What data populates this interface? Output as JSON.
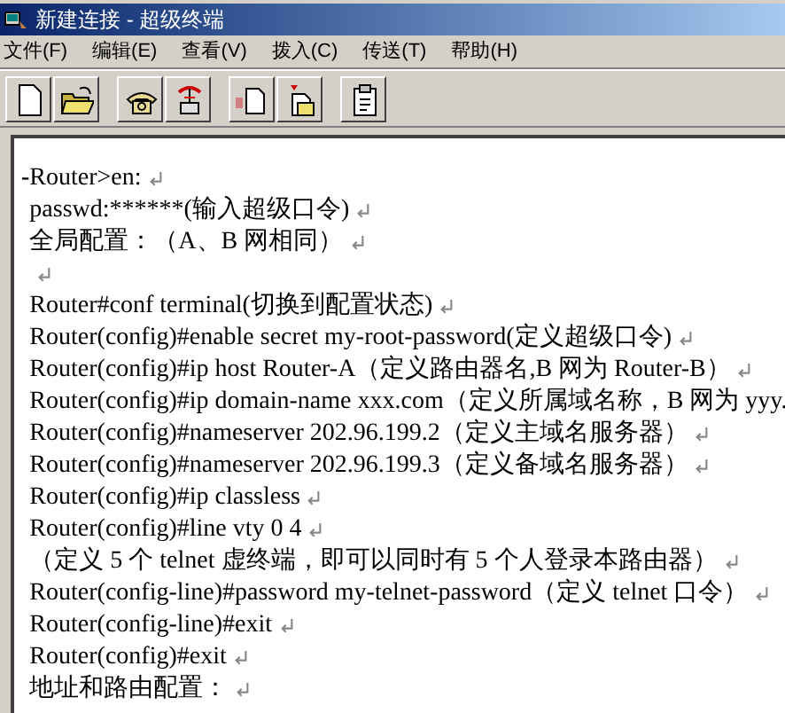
{
  "window": {
    "title": "新建连接 - 超级终端"
  },
  "menu": [
    "文件(F)",
    "编辑(E)",
    "查看(V)",
    "拨入(C)",
    "传送(T)",
    "帮助(H)"
  ],
  "toolbar": [
    {
      "kind": "new"
    },
    {
      "kind": "open"
    },
    {
      "kind": "separator"
    },
    {
      "kind": "call"
    },
    {
      "kind": "hangup"
    },
    {
      "kind": "separator"
    },
    {
      "kind": "send"
    },
    {
      "kind": "receive"
    },
    {
      "kind": "separator"
    },
    {
      "kind": "properties"
    }
  ],
  "terminal": {
    "cursor": "-",
    "lines": [
      {
        "text": "Router>en:",
        "mark": true
      },
      {
        "text": "passwd:******(输入超级口令)",
        "mark": true
      },
      {
        "text": "全局配置：（A、B 网相同）",
        "mark": true
      },
      {
        "mark": true
      },
      {
        "text": "Router#conf terminal(切换到配置状态)",
        "mark": true
      },
      {
        "text": "Router(config)#enable secret my-root-password(定义超级口令)",
        "mark": true
      },
      {
        "text": "Router(config)#ip host Router-A（定义路由器名,B 网为 Router-B）",
        "mark": true
      },
      {
        "text": "Router(config)#ip domain-name xxx.com（定义所属域名称，B 网为 yyy."
      },
      {
        "text": "Router(config)#nameserver 202.96.199.2（定义主域名服务器）",
        "mark": true
      },
      {
        "text": "Router(config)#nameserver 202.96.199.3（定义备域名服务器）",
        "mark": true
      },
      {
        "text": "Router(config)#ip classless",
        "mark": true
      },
      {
        "text": "Router(config)#line vty 0 4",
        "mark": true
      },
      {
        "text": "（定义 5 个 telnet 虚终端，即可以同时有 5 个人登录本路由器）",
        "mark": true
      },
      {
        "text": "Router(config-line)#password my-telnet-password（定义 telnet 口令）",
        "mark": true
      },
      {
        "text": "Router(config-line)#exit",
        "mark": true
      },
      {
        "text": "Router(config)#exit",
        "mark": true
      },
      {
        "text": "地址和路由配置：",
        "mark": true
      }
    ]
  }
}
